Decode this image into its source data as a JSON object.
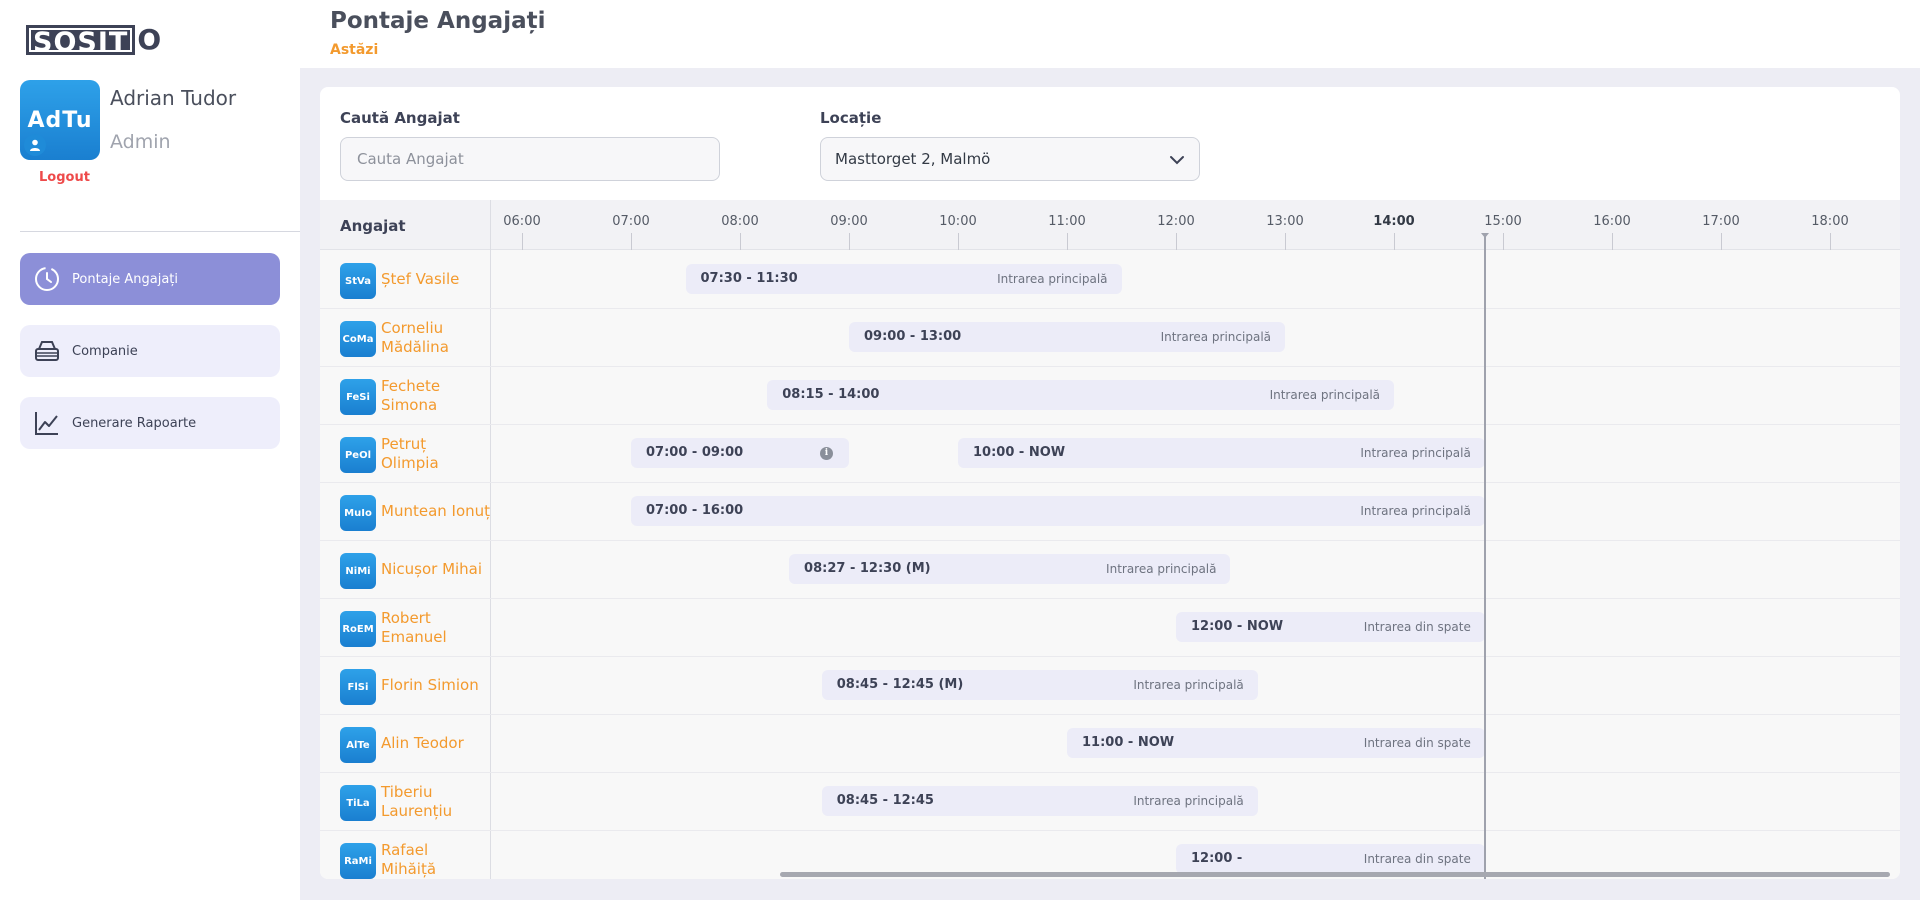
{
  "brand": {
    "logo_text": "SOSIT",
    "logo_tail": "O"
  },
  "user": {
    "initials": "AdTu",
    "name": "Adrian Tudor",
    "role": "Admin",
    "logout_label": "Logout"
  },
  "nav": [
    {
      "label": "Pontaje Angajați",
      "icon": "clock-icon",
      "active": true
    },
    {
      "label": "Companie",
      "icon": "building-icon",
      "active": false
    },
    {
      "label": "Generare Rapoarte",
      "icon": "chart-line-icon",
      "active": false
    }
  ],
  "header": {
    "title": "Pontaje Angajați",
    "subtitle": "Astăzi"
  },
  "filters": {
    "search": {
      "label": "Caută Angajat",
      "placeholder": "Cauta Angajat",
      "value": ""
    },
    "location": {
      "label": "Locație",
      "value": "Masttorget 2,  Malmö",
      "icon": "chevron-down-icon"
    }
  },
  "timeline": {
    "column_title": "Angajat",
    "hours": [
      "06:00",
      "07:00",
      "08:00",
      "09:00",
      "10:00",
      "11:00",
      "12:00",
      "13:00",
      "14:00",
      "15:00",
      "16:00",
      "17:00",
      "18:00"
    ],
    "current_hour": "14:00",
    "now_time": "14:50",
    "rows": [
      {
        "initials": "StVa",
        "name": "Ștef Vasile",
        "shifts": [
          {
            "start": "07:30",
            "end": "11:30",
            "label": "07:30 - 11:30",
            "entrance": "Intrarea principală"
          }
        ]
      },
      {
        "initials": "CoMa",
        "name": "Corneliu Mădălina",
        "shifts": [
          {
            "start": "09:00",
            "end": "13:00",
            "label": "09:00 - 13:00",
            "entrance": "Intrarea principală"
          }
        ]
      },
      {
        "initials": "FeSi",
        "name": "Fechete Simona",
        "shifts": [
          {
            "start": "08:15",
            "end": "14:00",
            "label": "08:15 - 14:00",
            "entrance": "Intrarea principală"
          }
        ]
      },
      {
        "initials": "PeOl",
        "name": "Petruț Olimpia",
        "shifts": [
          {
            "start": "07:00",
            "end": "09:00",
            "label": "07:00 - 09:00",
            "entrance": "",
            "info": true
          },
          {
            "start": "10:00",
            "end": "NOW",
            "label": "10:00 - NOW",
            "entrance": "Intrarea principală"
          }
        ]
      },
      {
        "initials": "MuIo",
        "name": "Muntean Ionuț",
        "shifts": [
          {
            "start": "07:00",
            "end": "NOW",
            "label": "07:00 - 16:00",
            "entrance": "Intrarea principală"
          }
        ]
      },
      {
        "initials": "NiMi",
        "name": "Nicușor Mihai",
        "shifts": [
          {
            "start": "08:27",
            "end": "12:30",
            "label": "08:27 - 12:30 (M)",
            "entrance": "Intrarea principală"
          }
        ]
      },
      {
        "initials": "RoEM",
        "name": "Robert Emanuel",
        "shifts": [
          {
            "start": "12:00",
            "end": "NOW",
            "label": "12:00 - NOW",
            "entrance": "Intrarea din spate"
          }
        ]
      },
      {
        "initials": "FlSi",
        "name": "Florin Simion",
        "shifts": [
          {
            "start": "08:45",
            "end": "12:45",
            "label": "08:45 - 12:45 (M)",
            "entrance": "Intrarea principală"
          }
        ]
      },
      {
        "initials": "AlTe",
        "name": "Alin Teodor",
        "shifts": [
          {
            "start": "11:00",
            "end": "NOW",
            "label": "11:00 - NOW",
            "entrance": "Intrarea din spate"
          }
        ]
      },
      {
        "initials": "TiLa",
        "name": "Tiberiu Laurențiu",
        "shifts": [
          {
            "start": "08:45",
            "end": "12:45",
            "label": "08:45 - 12:45",
            "entrance": "Intrarea principală"
          }
        ]
      },
      {
        "initials": "RaMi",
        "name": "Rafael Mihăiță",
        "shifts": [
          {
            "start": "12:00",
            "end": "NOW",
            "label": "12:00  -",
            "entrance": "Intrarea din spate"
          }
        ]
      }
    ]
  },
  "colors": {
    "accent": "#8c8fd8",
    "name_orange": "#f39a2e",
    "avatar_blue": "#1f8bd8",
    "logout_red": "#ee4a4a"
  }
}
